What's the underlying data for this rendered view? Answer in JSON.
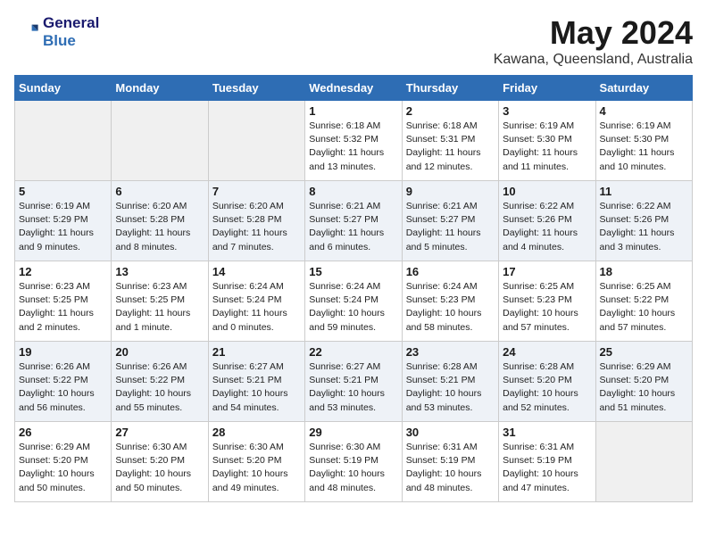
{
  "header": {
    "logo_line1": "General",
    "logo_line2": "Blue",
    "month": "May 2024",
    "location": "Kawana, Queensland, Australia"
  },
  "weekdays": [
    "Sunday",
    "Monday",
    "Tuesday",
    "Wednesday",
    "Thursday",
    "Friday",
    "Saturday"
  ],
  "weeks": [
    [
      {
        "day": "",
        "info": ""
      },
      {
        "day": "",
        "info": ""
      },
      {
        "day": "",
        "info": ""
      },
      {
        "day": "1",
        "info": "Sunrise: 6:18 AM\nSunset: 5:32 PM\nDaylight: 11 hours\nand 13 minutes."
      },
      {
        "day": "2",
        "info": "Sunrise: 6:18 AM\nSunset: 5:31 PM\nDaylight: 11 hours\nand 12 minutes."
      },
      {
        "day": "3",
        "info": "Sunrise: 6:19 AM\nSunset: 5:30 PM\nDaylight: 11 hours\nand 11 minutes."
      },
      {
        "day": "4",
        "info": "Sunrise: 6:19 AM\nSunset: 5:30 PM\nDaylight: 11 hours\nand 10 minutes."
      }
    ],
    [
      {
        "day": "5",
        "info": "Sunrise: 6:19 AM\nSunset: 5:29 PM\nDaylight: 11 hours\nand 9 minutes."
      },
      {
        "day": "6",
        "info": "Sunrise: 6:20 AM\nSunset: 5:28 PM\nDaylight: 11 hours\nand 8 minutes."
      },
      {
        "day": "7",
        "info": "Sunrise: 6:20 AM\nSunset: 5:28 PM\nDaylight: 11 hours\nand 7 minutes."
      },
      {
        "day": "8",
        "info": "Sunrise: 6:21 AM\nSunset: 5:27 PM\nDaylight: 11 hours\nand 6 minutes."
      },
      {
        "day": "9",
        "info": "Sunrise: 6:21 AM\nSunset: 5:27 PM\nDaylight: 11 hours\nand 5 minutes."
      },
      {
        "day": "10",
        "info": "Sunrise: 6:22 AM\nSunset: 5:26 PM\nDaylight: 11 hours\nand 4 minutes."
      },
      {
        "day": "11",
        "info": "Sunrise: 6:22 AM\nSunset: 5:26 PM\nDaylight: 11 hours\nand 3 minutes."
      }
    ],
    [
      {
        "day": "12",
        "info": "Sunrise: 6:23 AM\nSunset: 5:25 PM\nDaylight: 11 hours\nand 2 minutes."
      },
      {
        "day": "13",
        "info": "Sunrise: 6:23 AM\nSunset: 5:25 PM\nDaylight: 11 hours\nand 1 minute."
      },
      {
        "day": "14",
        "info": "Sunrise: 6:24 AM\nSunset: 5:24 PM\nDaylight: 11 hours\nand 0 minutes."
      },
      {
        "day": "15",
        "info": "Sunrise: 6:24 AM\nSunset: 5:24 PM\nDaylight: 10 hours\nand 59 minutes."
      },
      {
        "day": "16",
        "info": "Sunrise: 6:24 AM\nSunset: 5:23 PM\nDaylight: 10 hours\nand 58 minutes."
      },
      {
        "day": "17",
        "info": "Sunrise: 6:25 AM\nSunset: 5:23 PM\nDaylight: 10 hours\nand 57 minutes."
      },
      {
        "day": "18",
        "info": "Sunrise: 6:25 AM\nSunset: 5:22 PM\nDaylight: 10 hours\nand 57 minutes."
      }
    ],
    [
      {
        "day": "19",
        "info": "Sunrise: 6:26 AM\nSunset: 5:22 PM\nDaylight: 10 hours\nand 56 minutes."
      },
      {
        "day": "20",
        "info": "Sunrise: 6:26 AM\nSunset: 5:22 PM\nDaylight: 10 hours\nand 55 minutes."
      },
      {
        "day": "21",
        "info": "Sunrise: 6:27 AM\nSunset: 5:21 PM\nDaylight: 10 hours\nand 54 minutes."
      },
      {
        "day": "22",
        "info": "Sunrise: 6:27 AM\nSunset: 5:21 PM\nDaylight: 10 hours\nand 53 minutes."
      },
      {
        "day": "23",
        "info": "Sunrise: 6:28 AM\nSunset: 5:21 PM\nDaylight: 10 hours\nand 53 minutes."
      },
      {
        "day": "24",
        "info": "Sunrise: 6:28 AM\nSunset: 5:20 PM\nDaylight: 10 hours\nand 52 minutes."
      },
      {
        "day": "25",
        "info": "Sunrise: 6:29 AM\nSunset: 5:20 PM\nDaylight: 10 hours\nand 51 minutes."
      }
    ],
    [
      {
        "day": "26",
        "info": "Sunrise: 6:29 AM\nSunset: 5:20 PM\nDaylight: 10 hours\nand 50 minutes."
      },
      {
        "day": "27",
        "info": "Sunrise: 6:30 AM\nSunset: 5:20 PM\nDaylight: 10 hours\nand 50 minutes."
      },
      {
        "day": "28",
        "info": "Sunrise: 6:30 AM\nSunset: 5:20 PM\nDaylight: 10 hours\nand 49 minutes."
      },
      {
        "day": "29",
        "info": "Sunrise: 6:30 AM\nSunset: 5:19 PM\nDaylight: 10 hours\nand 48 minutes."
      },
      {
        "day": "30",
        "info": "Sunrise: 6:31 AM\nSunset: 5:19 PM\nDaylight: 10 hours\nand 48 minutes."
      },
      {
        "day": "31",
        "info": "Sunrise: 6:31 AM\nSunset: 5:19 PM\nDaylight: 10 hours\nand 47 minutes."
      },
      {
        "day": "",
        "info": ""
      }
    ]
  ]
}
